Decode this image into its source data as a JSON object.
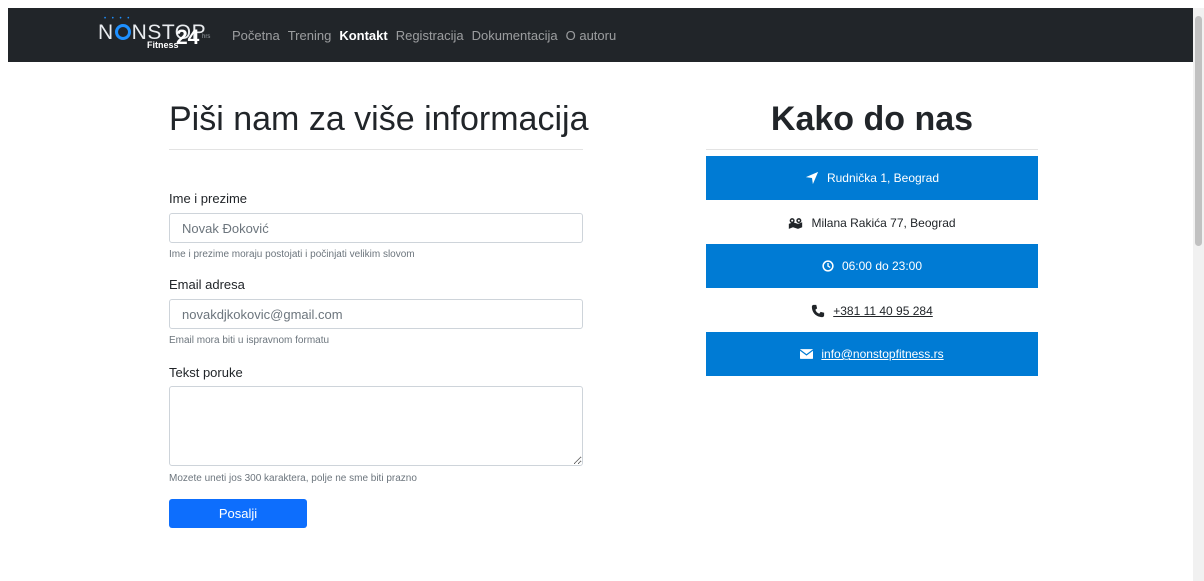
{
  "brand": {
    "name_prefix": "N",
    "name_suffix": "NSTOP",
    "sub": "Fitness",
    "number": "24",
    "hours_mark": "hrs"
  },
  "nav": {
    "items": [
      "Početna",
      "Trening",
      "Kontakt",
      "Registracija",
      "Dokumentacija",
      "O autoru"
    ],
    "active": "Kontakt"
  },
  "form": {
    "title": "Piši nam za više informacija",
    "name_label": "Ime i prezime",
    "name_value": "Novak Đoković",
    "name_help": "Ime i prezime moraju postojati i počinjati velikim slovom",
    "email_label": "Email adresa",
    "email_value": "novakdjkokovic@gmail.com",
    "email_help": "Email mora biti u ispravnom formatu",
    "message_label": "Tekst poruke",
    "message_value": "",
    "message_help": "Mozete uneti jos 300 karaktera, polje ne sme biti prazno",
    "submit_label": "Posalji"
  },
  "contact": {
    "title": "Kako do nas",
    "address_primary": "Rudnička 1, Beograd",
    "address_secondary": "Milana Rakića 77, Beograd",
    "hours": "06:00 do 23:00",
    "phone": "+381 11 40 95 284",
    "email": "info@nonstopfitness.rs"
  },
  "colors": {
    "navbar_bg": "#212529",
    "primary": "#0d6efd",
    "info_bg": "#007bd4",
    "logo_accent": "#1e90ff"
  },
  "icons": {
    "address_primary": "location-arrow-icon",
    "address_secondary": "map-marked-icon",
    "hours": "clock-icon",
    "phone": "phone-icon",
    "email": "envelope-icon"
  }
}
